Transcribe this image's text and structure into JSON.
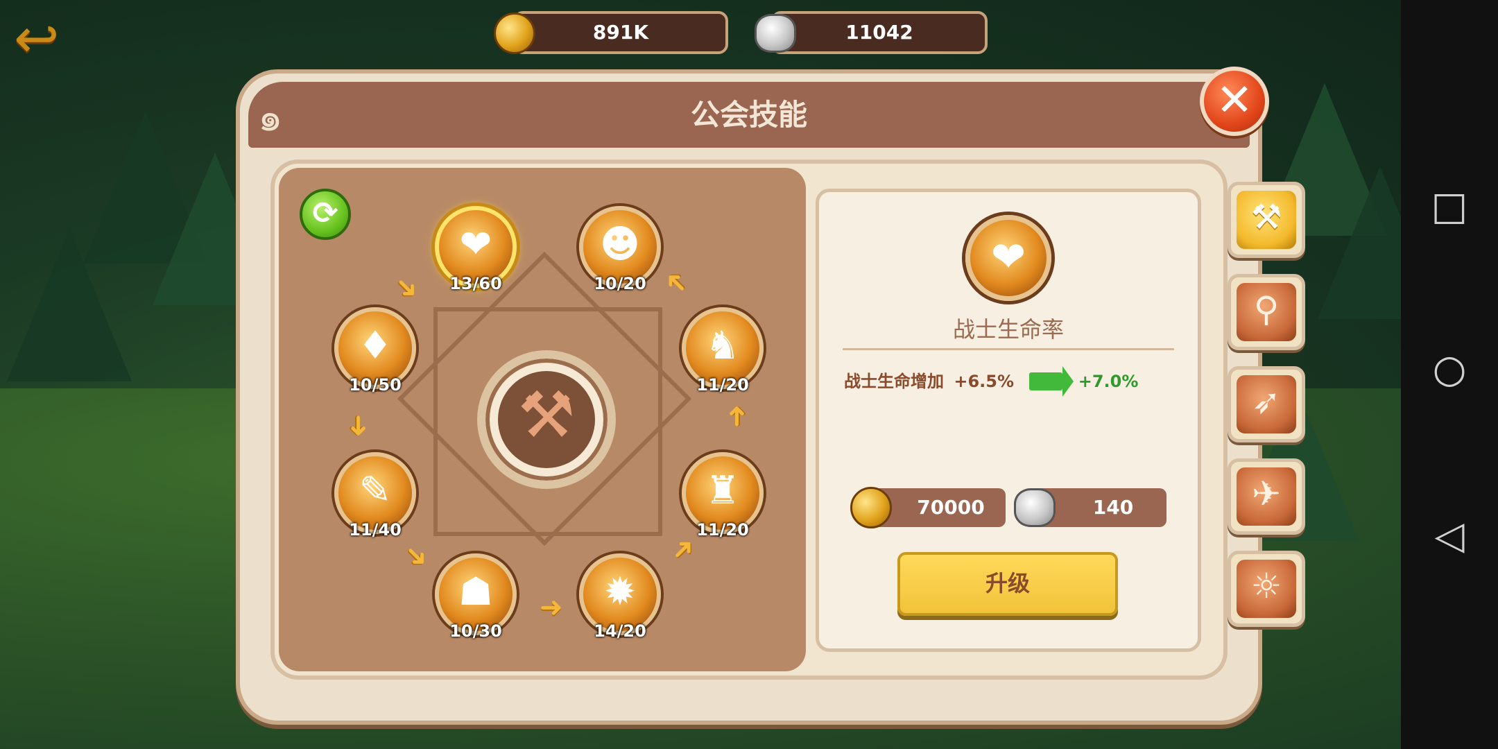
{
  "resources": {
    "gold": "891K",
    "stone": "11042"
  },
  "title": "公会技能",
  "skills": [
    {
      "key": "heal",
      "level": "13/60",
      "selected": true,
      "glyph": "❤"
    },
    {
      "key": "warrior-rage",
      "level": "10/20",
      "glyph": "☻"
    },
    {
      "key": "dark-hero",
      "level": "11/20",
      "glyph": "♞"
    },
    {
      "key": "runner",
      "level": "11/20",
      "glyph": "♜"
    },
    {
      "key": "burst",
      "level": "14/20",
      "glyph": "✹"
    },
    {
      "key": "grunt",
      "level": "10/30",
      "glyph": "☗"
    },
    {
      "key": "blade",
      "level": "11/40",
      "glyph": "✎"
    },
    {
      "key": "sword",
      "level": "10/50",
      "glyph": "♦"
    }
  ],
  "detail": {
    "name": "战士生命率",
    "effect_label": "战士生命增加",
    "current": "+6.5%",
    "next": "+7.0%",
    "cost_gold": "70000",
    "cost_stone": "140",
    "upgrade_label": "升级"
  },
  "icons": {
    "back": "back-arrow-icon",
    "close": "close-icon",
    "refresh": "refresh-icon",
    "center": "hammer-icon"
  },
  "tabs": [
    {
      "key": "hammer",
      "active": true
    },
    {
      "key": "staff"
    },
    {
      "key": "bow"
    },
    {
      "key": "boots"
    },
    {
      "key": "wings"
    }
  ],
  "colors": {
    "accent": "#9b6651",
    "button": "#f2c33a",
    "positive": "#2d9a2a"
  }
}
